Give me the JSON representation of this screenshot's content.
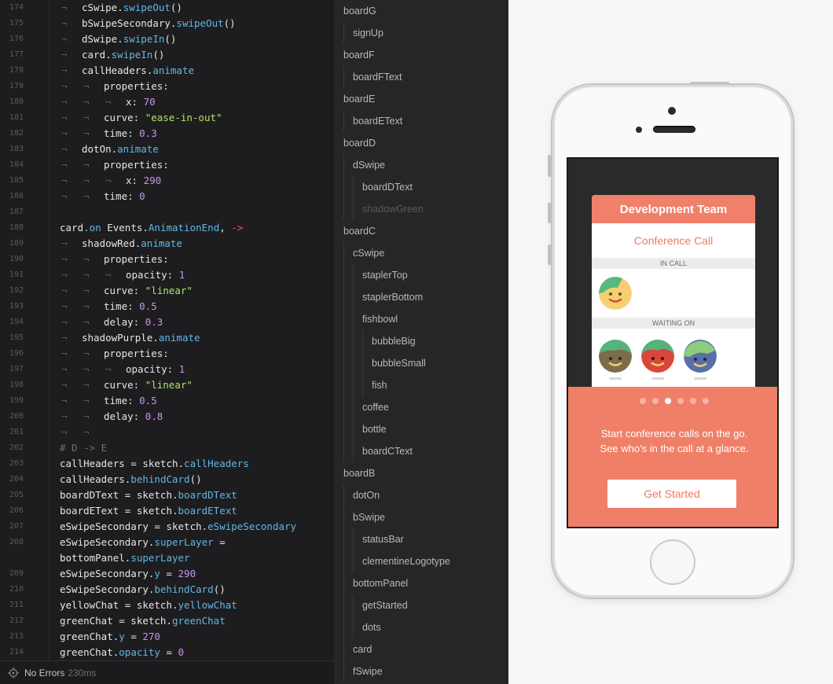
{
  "editor": {
    "tab_glyph": "¬",
    "lines": [
      {
        "n": "174",
        "indent": 1,
        "tokens": [
          {
            "t": "cSwipe."
          },
          {
            "t": "swipeOut",
            "c": "m"
          },
          {
            "t": "()"
          }
        ]
      },
      {
        "n": "175",
        "indent": 1,
        "tokens": [
          {
            "t": "bSwipeSecondary."
          },
          {
            "t": "swipeOut",
            "c": "m"
          },
          {
            "t": "()"
          }
        ]
      },
      {
        "n": "176",
        "indent": 1,
        "tokens": [
          {
            "t": "dSwipe."
          },
          {
            "t": "swipeIn",
            "c": "m"
          },
          {
            "t": "()"
          }
        ]
      },
      {
        "n": "177",
        "indent": 1,
        "tokens": [
          {
            "t": "card."
          },
          {
            "t": "swipeIn",
            "c": "m"
          },
          {
            "t": "()"
          }
        ]
      },
      {
        "n": "178",
        "indent": 1,
        "tokens": [
          {
            "t": "callHeaders."
          },
          {
            "t": "animate",
            "c": "m"
          }
        ]
      },
      {
        "n": "179",
        "indent": 2,
        "tokens": [
          {
            "t": "properties:"
          }
        ]
      },
      {
        "n": "180",
        "indent": 3,
        "tokens": [
          {
            "t": "x: "
          },
          {
            "t": "70",
            "c": "n"
          }
        ]
      },
      {
        "n": "181",
        "indent": 2,
        "tokens": [
          {
            "t": "curve: "
          },
          {
            "t": "\"ease-in-out\"",
            "c": "s"
          }
        ]
      },
      {
        "n": "182",
        "indent": 2,
        "tokens": [
          {
            "t": "time: "
          },
          {
            "t": "0.3",
            "c": "n"
          }
        ]
      },
      {
        "n": "183",
        "indent": 1,
        "tokens": [
          {
            "t": "dotOn."
          },
          {
            "t": "animate",
            "c": "m"
          }
        ]
      },
      {
        "n": "184",
        "indent": 2,
        "tokens": [
          {
            "t": "properties:"
          }
        ]
      },
      {
        "n": "185",
        "indent": 3,
        "tokens": [
          {
            "t": "x: "
          },
          {
            "t": "290",
            "c": "n"
          }
        ]
      },
      {
        "n": "186",
        "indent": 2,
        "tokens": [
          {
            "t": "time: "
          },
          {
            "t": "0",
            "c": "n"
          }
        ]
      },
      {
        "n": "187",
        "indent": 0,
        "tokens": []
      },
      {
        "n": "188",
        "indent": 0,
        "tokens": [
          {
            "t": "card"
          },
          {
            "t": ".on",
            "c": "m"
          },
          {
            "t": " Events."
          },
          {
            "t": "AnimationEnd",
            "c": "m"
          },
          {
            "t": ", "
          },
          {
            "t": "->",
            "c": "a"
          }
        ]
      },
      {
        "n": "189",
        "indent": 1,
        "tokens": [
          {
            "t": "shadowRed."
          },
          {
            "t": "animate",
            "c": "m"
          }
        ]
      },
      {
        "n": "190",
        "indent": 2,
        "tokens": [
          {
            "t": "properties:"
          }
        ]
      },
      {
        "n": "191",
        "indent": 3,
        "tokens": [
          {
            "t": "opacity: "
          },
          {
            "t": "1",
            "c": "n"
          }
        ]
      },
      {
        "n": "192",
        "indent": 2,
        "tokens": [
          {
            "t": "curve: "
          },
          {
            "t": "\"linear\"",
            "c": "s"
          }
        ]
      },
      {
        "n": "193",
        "indent": 2,
        "tokens": [
          {
            "t": "time: "
          },
          {
            "t": "0.5",
            "c": "n"
          }
        ]
      },
      {
        "n": "194",
        "indent": 2,
        "tokens": [
          {
            "t": "delay: "
          },
          {
            "t": "0.3",
            "c": "n"
          }
        ]
      },
      {
        "n": "195",
        "indent": 1,
        "tokens": [
          {
            "t": "shadowPurple."
          },
          {
            "t": "animate",
            "c": "m"
          }
        ]
      },
      {
        "n": "196",
        "indent": 2,
        "tokens": [
          {
            "t": "properties:"
          }
        ]
      },
      {
        "n": "197",
        "indent": 3,
        "tokens": [
          {
            "t": "opacity: "
          },
          {
            "t": "1",
            "c": "n"
          }
        ]
      },
      {
        "n": "198",
        "indent": 2,
        "tokens": [
          {
            "t": "curve: "
          },
          {
            "t": "\"linear\"",
            "c": "s"
          }
        ]
      },
      {
        "n": "199",
        "indent": 2,
        "tokens": [
          {
            "t": "time: "
          },
          {
            "t": "0.5",
            "c": "n"
          }
        ]
      },
      {
        "n": "200",
        "indent": 2,
        "tokens": [
          {
            "t": "delay: "
          },
          {
            "t": "0.8",
            "c": "n"
          }
        ]
      },
      {
        "n": "201",
        "indent": 2,
        "tokens": []
      },
      {
        "n": "202",
        "indent": 0,
        "tokens": [
          {
            "t": "# D -> E",
            "c": "c"
          }
        ]
      },
      {
        "n": "203",
        "indent": 0,
        "tokens": [
          {
            "t": "callHeaders = sketch."
          },
          {
            "t": "callHeaders",
            "c": "m"
          }
        ]
      },
      {
        "n": "204",
        "indent": 0,
        "tokens": [
          {
            "t": "callHeaders."
          },
          {
            "t": "behindCard",
            "c": "m"
          },
          {
            "t": "()"
          }
        ]
      },
      {
        "n": "205",
        "indent": 0,
        "tokens": [
          {
            "t": "boardDText = sketch."
          },
          {
            "t": "boardDText",
            "c": "m"
          }
        ]
      },
      {
        "n": "206",
        "indent": 0,
        "tokens": [
          {
            "t": "boardEText = sketch."
          },
          {
            "t": "boardEText",
            "c": "m"
          }
        ]
      },
      {
        "n": "207",
        "indent": 0,
        "tokens": [
          {
            "t": "eSwipeSecondary = sketch."
          },
          {
            "t": "eSwipeSecondary",
            "c": "m"
          }
        ]
      },
      {
        "n": "208",
        "indent": 0,
        "wrap": true,
        "tokens": [
          {
            "t": "eSwipeSecondary."
          },
          {
            "t": "superLayer",
            "c": "m"
          },
          {
            "t": " =\nbottomPanel."
          },
          {
            "t": "superLayer",
            "c": "m"
          }
        ]
      },
      {
        "n": "209",
        "indent": 0,
        "tokens": [
          {
            "t": "eSwipeSecondary."
          },
          {
            "t": "y",
            "c": "m"
          },
          {
            "t": " = "
          },
          {
            "t": "290",
            "c": "n"
          }
        ]
      },
      {
        "n": "210",
        "indent": 0,
        "tokens": [
          {
            "t": "eSwipeSecondary."
          },
          {
            "t": "behindCard",
            "c": "m"
          },
          {
            "t": "()"
          }
        ]
      },
      {
        "n": "211",
        "indent": 0,
        "tokens": [
          {
            "t": "yellowChat = sketch."
          },
          {
            "t": "yellowChat",
            "c": "m"
          }
        ]
      },
      {
        "n": "212",
        "indent": 0,
        "tokens": [
          {
            "t": "greenChat = sketch."
          },
          {
            "t": "greenChat",
            "c": "m"
          }
        ]
      },
      {
        "n": "213",
        "indent": 0,
        "tokens": [
          {
            "t": "greenChat."
          },
          {
            "t": "y",
            "c": "m"
          },
          {
            "t": " = "
          },
          {
            "t": "270",
            "c": "n"
          }
        ]
      },
      {
        "n": "214",
        "indent": 0,
        "tokens": [
          {
            "t": "greenChat."
          },
          {
            "t": "opacity",
            "c": "m"
          },
          {
            "t": " = "
          },
          {
            "t": "0",
            "c": "n"
          }
        ]
      }
    ]
  },
  "status": {
    "icon": "target-icon",
    "label": "No Errors",
    "time": "230ms"
  },
  "layers": [
    {
      "name": "boardG",
      "depth": 0
    },
    {
      "name": "signUp",
      "depth": 1
    },
    {
      "name": "boardF",
      "depth": 0
    },
    {
      "name": "boardFText",
      "depth": 1
    },
    {
      "name": "boardE",
      "depth": 0
    },
    {
      "name": "boardEText",
      "depth": 1
    },
    {
      "name": "boardD",
      "depth": 0
    },
    {
      "name": "dSwipe",
      "depth": 1
    },
    {
      "name": "boardDText",
      "depth": 2
    },
    {
      "name": "shadowGreen",
      "depth": 2,
      "dim": true
    },
    {
      "name": "boardC",
      "depth": 0
    },
    {
      "name": "cSwipe",
      "depth": 1
    },
    {
      "name": "staplerTop",
      "depth": 2
    },
    {
      "name": "staplerBottom",
      "depth": 2
    },
    {
      "name": "fishbowl",
      "depth": 2
    },
    {
      "name": "bubbleBig",
      "depth": 3
    },
    {
      "name": "bubbleSmall",
      "depth": 3
    },
    {
      "name": "fish",
      "depth": 3
    },
    {
      "name": "coffee",
      "depth": 2
    },
    {
      "name": "bottle",
      "depth": 2
    },
    {
      "name": "boardCText",
      "depth": 2
    },
    {
      "name": "boardB",
      "depth": 0
    },
    {
      "name": "dotOn",
      "depth": 1
    },
    {
      "name": "bSwipe",
      "depth": 1
    },
    {
      "name": "statusBar",
      "depth": 2
    },
    {
      "name": "clementineLogotype",
      "depth": 2
    },
    {
      "name": "bottomPanel",
      "depth": 1
    },
    {
      "name": "getStarted",
      "depth": 2
    },
    {
      "name": "dots",
      "depth": 2
    },
    {
      "name": "card",
      "depth": 1
    },
    {
      "name": "fSwipe",
      "depth": 1
    }
  ],
  "preview": {
    "card_title": "Development Team",
    "card_subtitle": "Conference Call",
    "in_call_label": "IN CALL",
    "waiting_label": "WAITING ON",
    "tagline_line1": "Start conference calls on the go.",
    "tagline_line2": "See who's in the call at a glance.",
    "cta_label": "Get Started",
    "dot_count": 6,
    "active_dot": 3
  },
  "colors": {
    "accent": "#f07f68",
    "keyword": "#62b6e7",
    "number": "#c792ea",
    "string": "#b4e06c",
    "arrow": "#ff4f8e"
  }
}
